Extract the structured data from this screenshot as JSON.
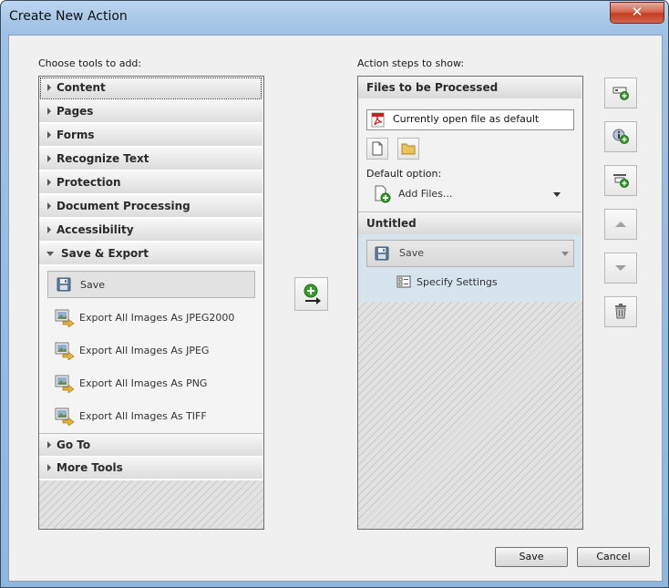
{
  "window": {
    "title": "Create New Action",
    "close_symbol": "✕"
  },
  "left": {
    "label": "Choose tools to add:",
    "categories_top": [
      {
        "label": "Content"
      },
      {
        "label": "Pages"
      },
      {
        "label": "Forms"
      },
      {
        "label": "Recognize Text"
      },
      {
        "label": "Protection"
      },
      {
        "label": "Document Processing"
      },
      {
        "label": "Accessibility"
      }
    ],
    "expanded_category": {
      "label": "Save & Export"
    },
    "tools": [
      {
        "label": "Save",
        "icon": "floppy-disk-icon"
      },
      {
        "label": "Export All Images As JPEG2000",
        "icon": "export-image-icon"
      },
      {
        "label": "Export All Images As JPEG",
        "icon": "export-image-icon"
      },
      {
        "label": "Export All Images As PNG",
        "icon": "export-image-icon"
      },
      {
        "label": "Export All Images As TIFF",
        "icon": "export-image-icon"
      }
    ],
    "categories_bottom": [
      {
        "label": "Go To"
      },
      {
        "label": "More Tools"
      }
    ]
  },
  "right": {
    "label": "Action steps to show:",
    "files_header": "Files to be Processed",
    "file_value": "Currently open file as default",
    "default_option_label": "Default option:",
    "default_option_value": "Add Files...",
    "untitled_header": "Untitled",
    "step_value": "Save",
    "specify_settings": "Specify Settings"
  },
  "footer": {
    "save_label": "Save",
    "cancel_label": "Cancel"
  },
  "colors": {
    "accent_blue": "#d6e4ee",
    "pdf_red": "#c8201e",
    "plus_green": "#3a9a2e"
  }
}
